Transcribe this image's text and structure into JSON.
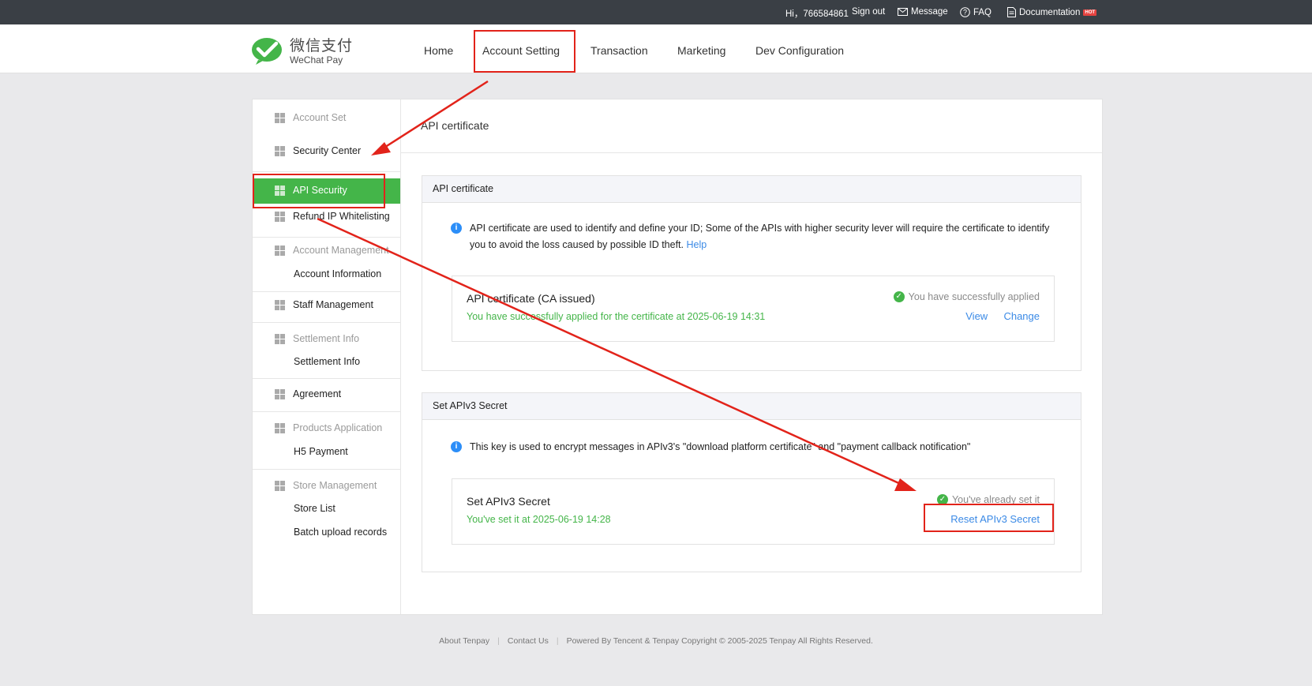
{
  "topbar": {
    "greeting": "Hi，766584861",
    "signout": "Sign out",
    "message": "Message",
    "faq": "FAQ",
    "documentation": "Documentation",
    "hot_badge": "HOT"
  },
  "brand": {
    "cn": "微信支付",
    "en": "WeChat Pay",
    "green": "#44b549"
  },
  "nav": {
    "home": "Home",
    "account_setting": "Account Setting",
    "transaction": "Transaction",
    "marketing": "Marketing",
    "dev_config": "Dev Configuration"
  },
  "sidebar": {
    "account_set": "Account Set",
    "security_center": "Security Center",
    "api_security": "API Security",
    "refund_ip": "Refund IP Whitelisting",
    "account_management": "Account Management",
    "account_information": "Account Information",
    "staff_management": "Staff Management",
    "settlement_info_group": "Settlement Info",
    "settlement_info": "Settlement Info",
    "agreement": "Agreement",
    "products_application": "Products Application",
    "h5_payment": "H5 Payment",
    "store_management": "Store Management",
    "store_list": "Store List",
    "batch_upload": "Batch upload records"
  },
  "content": {
    "title": "API certificate",
    "cert": {
      "header": "API certificate",
      "info": "API certificate are used to identify and define your ID; Some of the APIs with higher security lever will require the certificate to identify you to avoid the loss caused by possible ID theft.",
      "help": "Help",
      "card_title": "API certificate (CA issued)",
      "card_sub": "You have successfully applied for the certificate at 2025-06-19 14:31",
      "status": "You have successfully applied",
      "view": "View",
      "change": "Change"
    },
    "secret": {
      "header": "Set APIv3 Secret",
      "info": "This key is used to encrypt messages in APIv3's \"download platform certificate\" and \"payment callback notification\"",
      "card_title": "Set APIv3 Secret",
      "card_sub": "You've set it at 2025-06-19 14:28",
      "status": "You've already set it",
      "reset": "Reset APIv3 Secret"
    }
  },
  "footer": {
    "about": "About Tenpay",
    "contact": "Contact Us",
    "powered": "Powered By Tencent & Tenpay Copyright © 2005-2025 Tenpay All Rights Reserved."
  },
  "annotation_color": "#e2231a"
}
